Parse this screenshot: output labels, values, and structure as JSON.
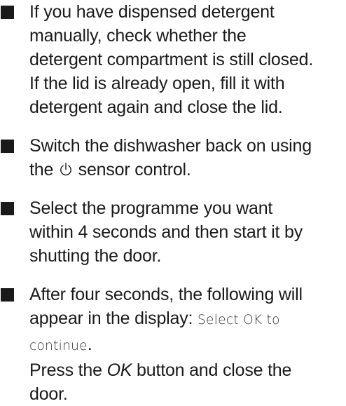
{
  "instructions": [
    {
      "lines": [
        "If you have dispensed detergent",
        "manually, check whether the",
        "detergent compartment is still closed.",
        "If the lid is already open, fill it with",
        "detergent again and close the lid."
      ]
    },
    {
      "line1": "Switch the dishwasher back on using",
      "line2_before": "the",
      "power_icon": "power-icon",
      "line2_after": "sensor control."
    },
    {
      "lines": [
        "Select the programme you want",
        "within 4 seconds and then start it by",
        "shutting the door."
      ]
    },
    {
      "line1": "After four seconds, the following will",
      "line2_prefix": "appear in the display:",
      "display_text_part1": "Select OK to",
      "display_text_part2": "continue",
      "line3_suffix": ".",
      "line4_prefix": "Press the",
      "button_name": "OK",
      "line4_suffix": "button and close the",
      "line5": "door."
    }
  ]
}
